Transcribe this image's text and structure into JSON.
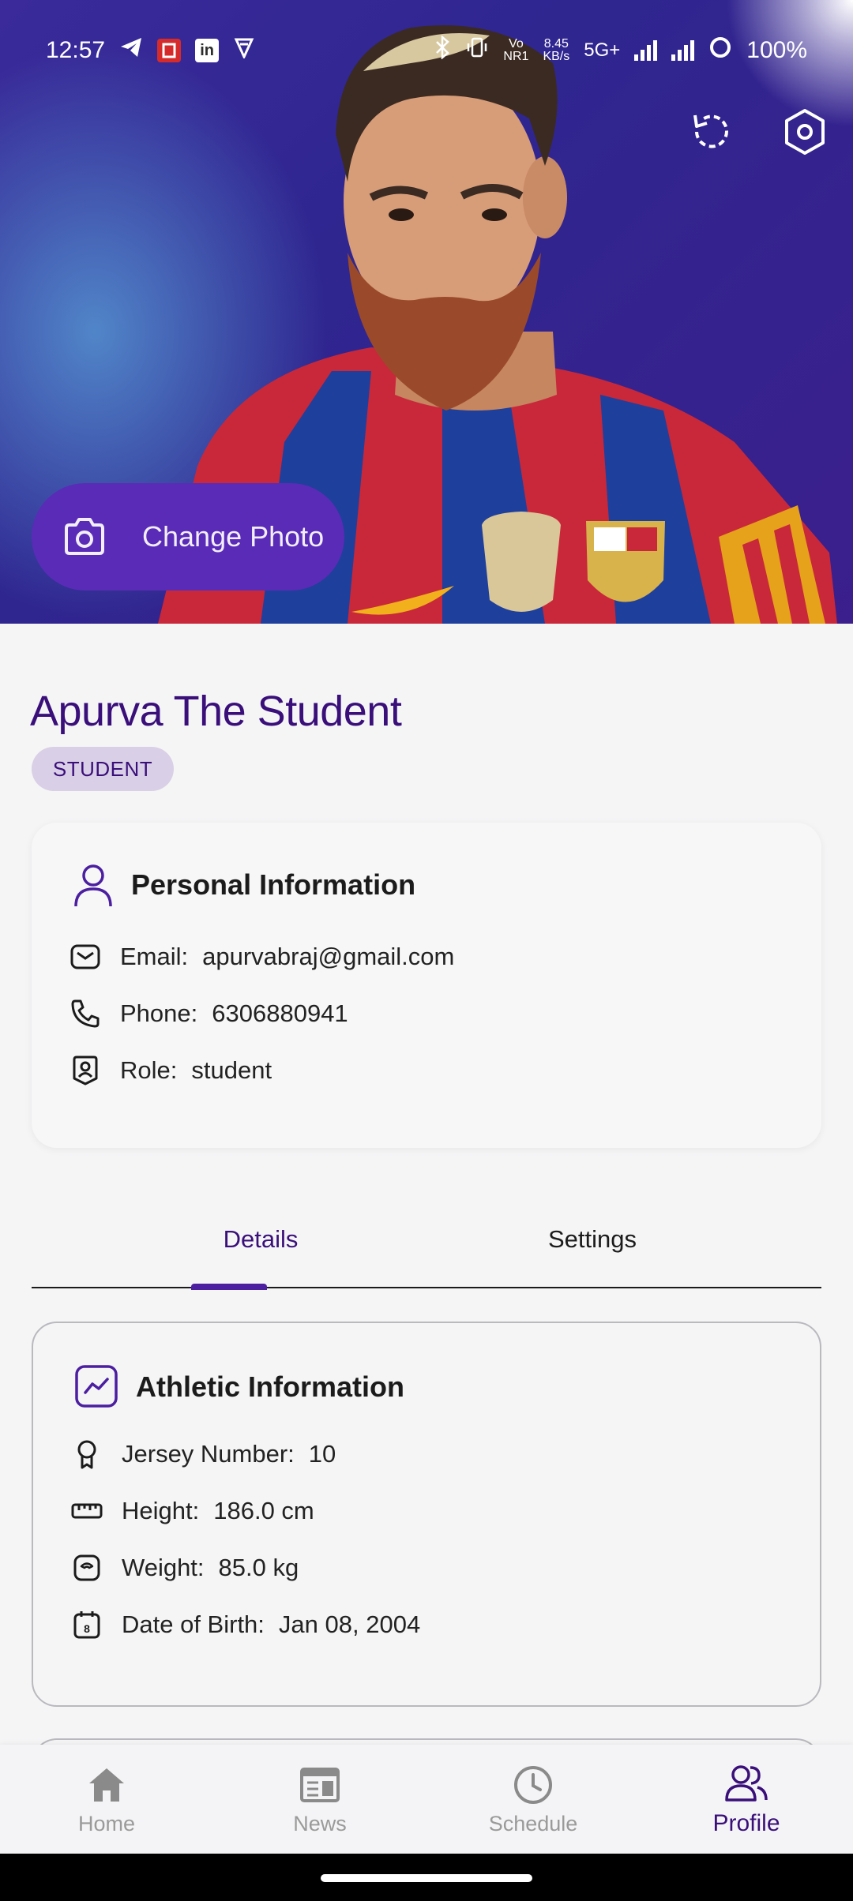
{
  "status_bar": {
    "time": "12:57",
    "net_speed_top": "8.45",
    "net_speed_bottom": "KB/s",
    "network": "5G+",
    "battery": "100%"
  },
  "hero": {
    "change_photo_label": "Change Photo"
  },
  "profile": {
    "name": "Apurva The Student",
    "role_chip": "STUDENT"
  },
  "personal_info": {
    "title": "Personal Information",
    "rows": [
      {
        "label": "Email:",
        "value": "apurvabraj@gmail.com"
      },
      {
        "label": "Phone:",
        "value": "6306880941"
      },
      {
        "label": "Role:",
        "value": "student"
      }
    ]
  },
  "tabs": [
    {
      "label": "Details",
      "active": true
    },
    {
      "label": "Settings",
      "active": false
    }
  ],
  "athletic_info": {
    "title": "Athletic Information",
    "rows": [
      {
        "label": "Jersey Number:",
        "value": "10"
      },
      {
        "label": "Height:",
        "value": "186.0 cm"
      },
      {
        "label": "Weight:",
        "value": "85.0 kg"
      },
      {
        "label": "Date of Birth:",
        "value": "Jan 08, 2004"
      }
    ]
  },
  "bottom_nav": [
    {
      "label": "Home",
      "icon": "home-icon",
      "active": false
    },
    {
      "label": "News",
      "icon": "news-icon",
      "active": false
    },
    {
      "label": "Schedule",
      "icon": "clock-icon",
      "active": false
    },
    {
      "label": "Profile",
      "icon": "people-icon",
      "active": true
    }
  ],
  "colors": {
    "primary": "#3a0f7a",
    "accent": "#5a2bb7",
    "chip_bg": "#d9cfe6",
    "inactive_nav": "#9a9a9a"
  }
}
